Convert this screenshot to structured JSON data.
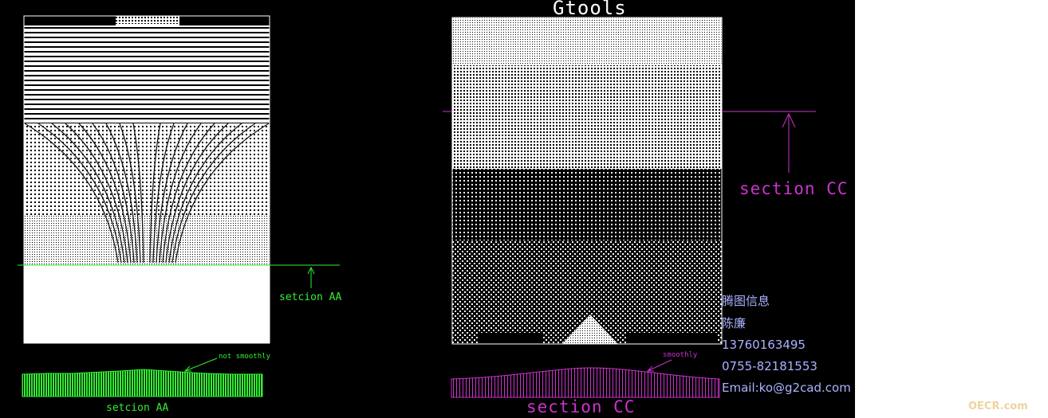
{
  "title": "Gtools",
  "left_view": {
    "section_label": "setcion AA",
    "profile_label": "setcion AA",
    "profile_note": "not smoothly"
  },
  "right_view": {
    "section_label": "section CC",
    "profile_label": "section CC",
    "profile_note": "smoothly"
  },
  "info": {
    "company": "腾图信息",
    "person": "陈廉",
    "mobile": "13760163495",
    "phone": "0755-82181553",
    "email": "Email:ko@g2cad.com"
  },
  "watermark": "OECR.com",
  "colors": {
    "background": "#000000",
    "panel": "#ffffff",
    "green": "#33ee33",
    "magenta": "#cc33cc",
    "info_text": "#aab2ff"
  }
}
